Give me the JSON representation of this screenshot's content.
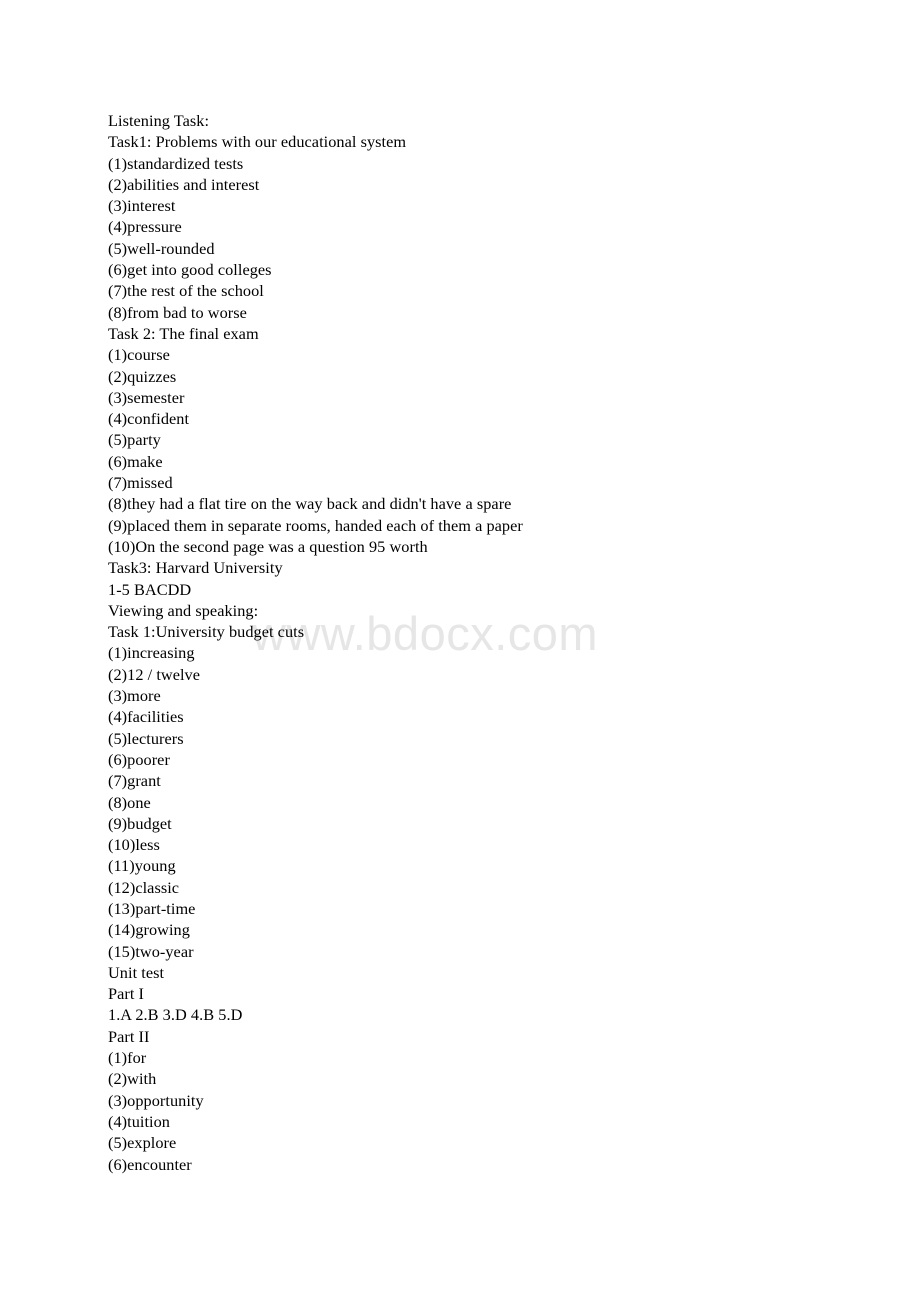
{
  "document": {
    "watermark": "www.bdocx.com",
    "lines": [
      "Listening Task:",
      "Task1: Problems with our educational system",
      "(1)standardized tests",
      "(2)abilities and interest",
      "(3)interest",
      "(4)pressure",
      "(5)well-rounded",
      "(6)get into good colleges",
      "(7)the rest of the school",
      "(8)from bad to worse",
      "Task 2: The final exam",
      "(1)course",
      "(2)quizzes",
      "(3)semester",
      "(4)confident",
      "(5)party",
      "(6)make",
      "(7)missed",
      "(8)they had a flat tire on the way back and didn't have a spare",
      "(9)placed them in separate rooms, handed each of them a paper",
      "(10)On the second page was a question 95 worth",
      "Task3: Harvard University",
      "1-5 BACDD",
      "Viewing and speaking:",
      "Task 1:University budget cuts",
      "(1)increasing",
      "(2)12 / twelve",
      "(3)more",
      "(4)facilities",
      "(5)lecturers",
      "(6)poorer",
      "(7)grant",
      "(8)one",
      "(9)budget",
      "(10)less",
      "(11)young",
      "(12)classic",
      "(13)part-time",
      "(14)growing",
      "(15)two-year",
      "Unit test",
      "Part I",
      "1.A 2.B 3.D 4.B 5.D",
      "Part II",
      "(1)for",
      "(2)with",
      "(3)opportunity",
      "(4)tuition",
      "(5)explore",
      "(6)encounter"
    ]
  },
  "colors": {
    "text": "#000000",
    "background": "#ffffff",
    "watermark": "#e6e6e6"
  }
}
